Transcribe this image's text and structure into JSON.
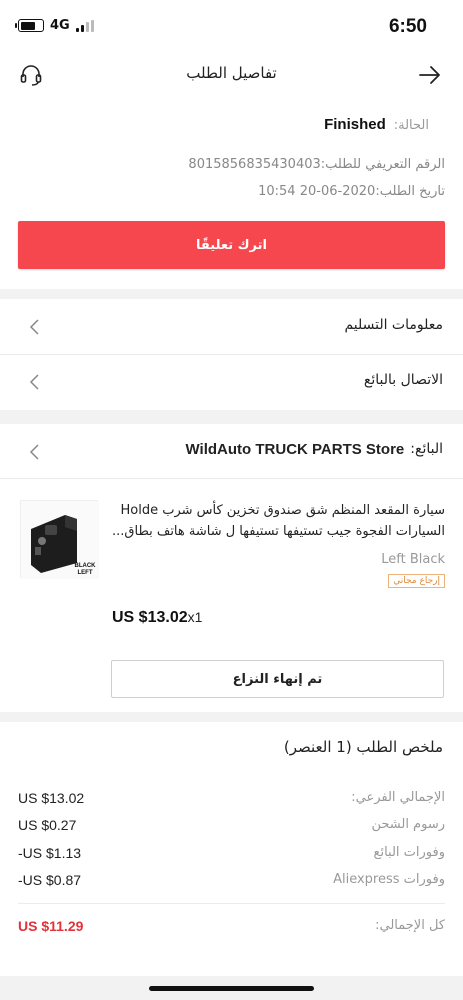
{
  "status_bar": {
    "network": "4G",
    "time": "6:50"
  },
  "header": {
    "title": "تفاصيل الطلب"
  },
  "order": {
    "status_label": "الحالة:",
    "status_value": "Finished",
    "order_number": "الرقم التعريفي للطلب:8015856835430403",
    "order_date": "تاريخ الطلب:2020-06-20 10:54"
  },
  "feedback_button": "اترك تعليقًا",
  "links": {
    "delivery_info": "معلومات التسليم",
    "contact_seller": "الاتصال بالبائع"
  },
  "seller": {
    "label": "البائع:",
    "store": "WildAuto TRUCK PARTS Store"
  },
  "product": {
    "title_line1": "سيارة المقعد المنظم شق صندوق تخزين كأس شرب Holde",
    "title_line2": "السيارات الفجوة جيب تستيفها تستيفها ل شاشة هاتف بطاق...",
    "variant": "Left Black",
    "free_return": "إرجاع مجاني",
    "price": "US $13.02",
    "qty": "x1",
    "image_text_1": "BLACK",
    "image_text_2": "LEFT"
  },
  "dispute_button": "تم إنهاء النزاع",
  "summary": {
    "title": "ملخص الطلب (1 العنصر)",
    "rows": [
      {
        "label": "الإجمالي الفرعي:",
        "value": "US $13.02"
      },
      {
        "label": "رسوم الشحن",
        "value": "US $0.27"
      },
      {
        "label": "وفورات البائع",
        "value": "-US $1.13"
      },
      {
        "label": "وفورات Aliexpress",
        "value": "-US $0.87"
      }
    ],
    "total_label": "كل الإجمالي:",
    "total_value": "US $11.29"
  },
  "colors": {
    "accent": "#f5474d",
    "total": "#e2323b",
    "separator": "#f2f2f2"
  }
}
